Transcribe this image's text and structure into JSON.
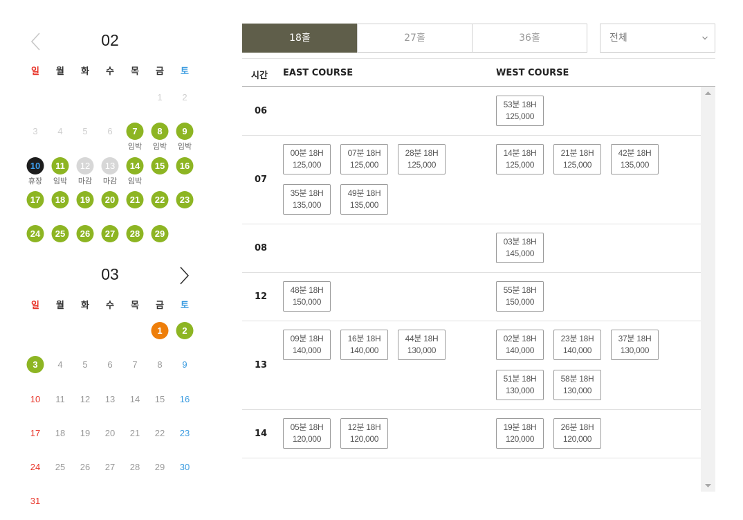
{
  "calendar": {
    "weekdays": [
      "일",
      "월",
      "화",
      "수",
      "목",
      "금",
      "토"
    ],
    "months": [
      {
        "label": "02",
        "prev_icon": "chevron-left-icon",
        "next_icon": "",
        "days": [
          {
            "n": "",
            "s": "blank"
          },
          {
            "n": "",
            "s": "blank"
          },
          {
            "n": "",
            "s": "blank"
          },
          {
            "n": "",
            "s": "blank"
          },
          {
            "n": "",
            "s": "blank"
          },
          {
            "n": "1",
            "s": "dim"
          },
          {
            "n": "2",
            "s": "dim"
          },
          {
            "n": "3",
            "s": "dim"
          },
          {
            "n": "4",
            "s": "dim"
          },
          {
            "n": "5",
            "s": "dim"
          },
          {
            "n": "6",
            "s": "dim"
          },
          {
            "n": "7",
            "s": "ok",
            "tag": "임박"
          },
          {
            "n": "8",
            "s": "ok",
            "tag": "임박"
          },
          {
            "n": "9",
            "s": "ok",
            "tag": "임박"
          },
          {
            "n": "10",
            "s": "today",
            "tag": "휴장"
          },
          {
            "n": "11",
            "s": "ok",
            "tag": "임박"
          },
          {
            "n": "12",
            "s": "closed",
            "tag": "마감"
          },
          {
            "n": "13",
            "s": "closed",
            "tag": "마감"
          },
          {
            "n": "14",
            "s": "ok",
            "tag": "임박"
          },
          {
            "n": "15",
            "s": "ok"
          },
          {
            "n": "16",
            "s": "ok"
          },
          {
            "n": "17",
            "s": "ok"
          },
          {
            "n": "18",
            "s": "ok"
          },
          {
            "n": "19",
            "s": "ok"
          },
          {
            "n": "20",
            "s": "ok"
          },
          {
            "n": "21",
            "s": "ok"
          },
          {
            "n": "22",
            "s": "ok"
          },
          {
            "n": "23",
            "s": "ok"
          },
          {
            "n": "24",
            "s": "ok"
          },
          {
            "n": "25",
            "s": "ok"
          },
          {
            "n": "26",
            "s": "ok"
          },
          {
            "n": "27",
            "s": "ok"
          },
          {
            "n": "28",
            "s": "ok"
          },
          {
            "n": "29",
            "s": "ok"
          }
        ]
      },
      {
        "label": "03",
        "prev_icon": "",
        "next_icon": "chevron-right-icon",
        "days": [
          {
            "n": "",
            "s": "blank"
          },
          {
            "n": "",
            "s": "blank"
          },
          {
            "n": "",
            "s": "blank"
          },
          {
            "n": "",
            "s": "blank"
          },
          {
            "n": "",
            "s": "blank"
          },
          {
            "n": "1",
            "s": "sel"
          },
          {
            "n": "2",
            "s": "ok"
          },
          {
            "n": "3",
            "s": "ok"
          },
          {
            "n": "4",
            "s": "plain"
          },
          {
            "n": "5",
            "s": "plain"
          },
          {
            "n": "6",
            "s": "plain"
          },
          {
            "n": "7",
            "s": "plain"
          },
          {
            "n": "8",
            "s": "plain"
          },
          {
            "n": "9",
            "s": "plain"
          },
          {
            "n": "10",
            "s": "plain"
          },
          {
            "n": "11",
            "s": "plain"
          },
          {
            "n": "12",
            "s": "plain"
          },
          {
            "n": "13",
            "s": "plain"
          },
          {
            "n": "14",
            "s": "plain"
          },
          {
            "n": "15",
            "s": "plain"
          },
          {
            "n": "16",
            "s": "plain"
          },
          {
            "n": "17",
            "s": "plain"
          },
          {
            "n": "18",
            "s": "plain"
          },
          {
            "n": "19",
            "s": "plain"
          },
          {
            "n": "20",
            "s": "plain"
          },
          {
            "n": "21",
            "s": "plain"
          },
          {
            "n": "22",
            "s": "plain"
          },
          {
            "n": "23",
            "s": "plain"
          },
          {
            "n": "24",
            "s": "plain"
          },
          {
            "n": "25",
            "s": "plain"
          },
          {
            "n": "26",
            "s": "plain"
          },
          {
            "n": "27",
            "s": "plain"
          },
          {
            "n": "28",
            "s": "plain"
          },
          {
            "n": "29",
            "s": "plain"
          },
          {
            "n": "30",
            "s": "plain"
          },
          {
            "n": "31",
            "s": "plain"
          }
        ]
      }
    ],
    "colors": {
      "available": "#8db523",
      "closed": "#d7d7d7",
      "today": "#1d1d1d",
      "selected": "#ee7e0a",
      "sunday": "#e8352a",
      "saturday": "#3c9ce0"
    }
  },
  "tabs": [
    {
      "label": "18홀",
      "active": true
    },
    {
      "label": "27홀",
      "active": false
    },
    {
      "label": "36홀",
      "active": false
    }
  ],
  "filter": {
    "value": "전체",
    "icon": "chevron-down-icon"
  },
  "table": {
    "headers": {
      "time": "시간",
      "east": "EAST COURSE",
      "west": "WEST COURSE"
    },
    "rows": [
      {
        "hour": "06",
        "east": [],
        "west": [
          {
            "time": "53분 18H",
            "price": "125,000"
          }
        ]
      },
      {
        "hour": "07",
        "east": [
          {
            "time": "00분 18H",
            "price": "125,000"
          },
          {
            "time": "07분 18H",
            "price": "125,000"
          },
          {
            "time": "28분 18H",
            "price": "125,000"
          },
          {
            "time": "35분 18H",
            "price": "135,000"
          },
          {
            "time": "49분 18H",
            "price": "135,000"
          }
        ],
        "west": [
          {
            "time": "14분 18H",
            "price": "125,000"
          },
          {
            "time": "21분 18H",
            "price": "125,000"
          },
          {
            "time": "42분 18H",
            "price": "135,000"
          }
        ]
      },
      {
        "hour": "08",
        "east": [],
        "west": [
          {
            "time": "03분 18H",
            "price": "145,000"
          }
        ]
      },
      {
        "hour": "12",
        "east": [
          {
            "time": "48분 18H",
            "price": "150,000"
          }
        ],
        "west": [
          {
            "time": "55분 18H",
            "price": "150,000"
          }
        ]
      },
      {
        "hour": "13",
        "east": [
          {
            "time": "09분 18H",
            "price": "140,000"
          },
          {
            "time": "16분 18H",
            "price": "140,000"
          },
          {
            "time": "44분 18H",
            "price": "130,000"
          }
        ],
        "west": [
          {
            "time": "02분 18H",
            "price": "140,000"
          },
          {
            "time": "23분 18H",
            "price": "140,000"
          },
          {
            "time": "37분 18H",
            "price": "130,000"
          },
          {
            "time": "51분 18H",
            "price": "130,000"
          },
          {
            "time": "58분 18H",
            "price": "130,000"
          }
        ]
      },
      {
        "hour": "14",
        "east": [
          {
            "time": "05분 18H",
            "price": "120,000"
          },
          {
            "time": "12분 18H",
            "price": "120,000"
          }
        ],
        "west": [
          {
            "time": "19분 18H",
            "price": "120,000"
          },
          {
            "time": "26분 18H",
            "price": "120,000"
          }
        ]
      }
    ]
  },
  "scrollbar": {
    "up_icon": "arrow-up-icon",
    "down_icon": "arrow-down-icon"
  },
  "accent": "#5f5e4a"
}
